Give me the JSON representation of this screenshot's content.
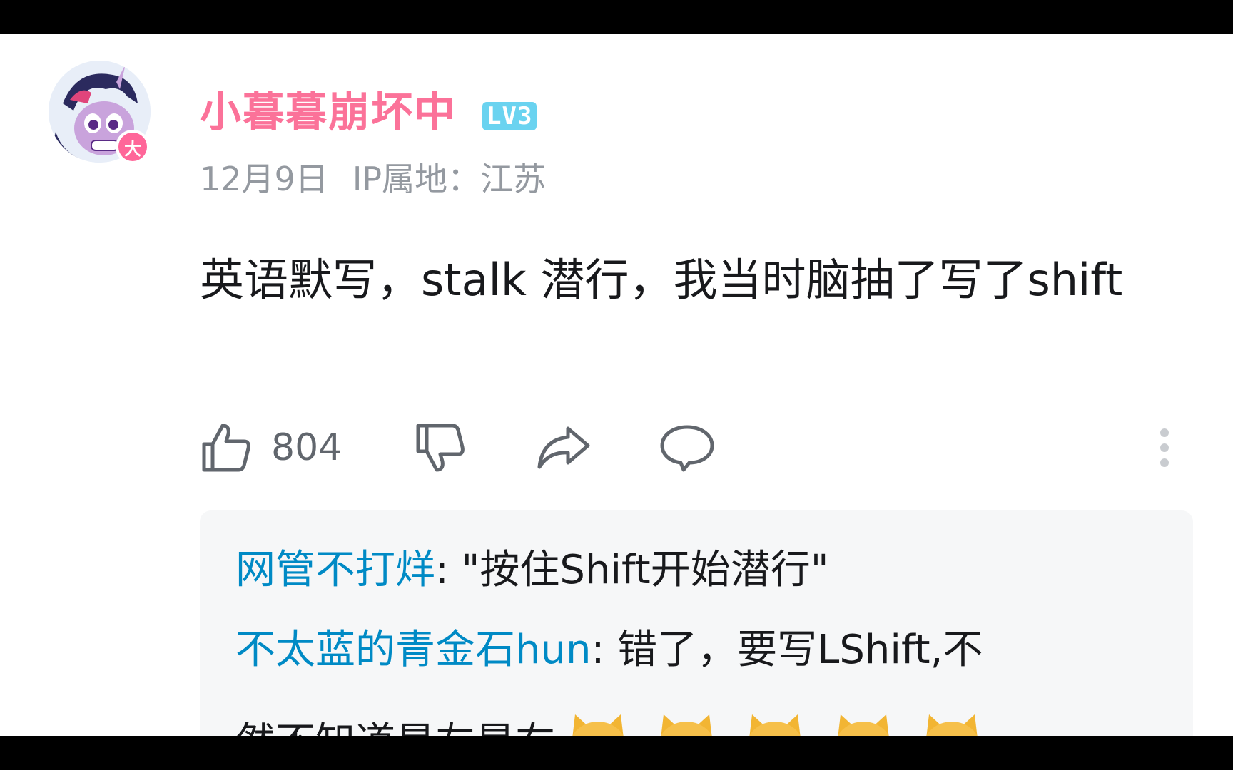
{
  "comment": {
    "username": "小暮暮崩坏中",
    "level": "LV3",
    "vip_badge": "大",
    "date": "12月9日",
    "ip_location": "IP属地：江苏",
    "text": "英语默写，stalk  潜行，我当时脑抽了写了shift"
  },
  "actions": {
    "like_count": "804",
    "icons": [
      "thumbs-up-icon",
      "thumbs-down-icon",
      "share-icon",
      "reply-icon",
      "more-icon"
    ]
  },
  "replies": [
    {
      "name": "网管不打烊",
      "sep": ": ",
      "text": "\"按住Shift开始潜行\""
    },
    {
      "name": "不太蓝的青金石hun",
      "sep": ": ",
      "text": "错了，要写LShift,不"
    },
    {
      "continuation": "然不知道是左是右",
      "emoji": "doge",
      "emoji_count": 5
    }
  ],
  "colors": {
    "username": "#fb7299",
    "level_badge": "#6ad3f0",
    "reply_name": "#008ac5",
    "meta_text": "#9499a0",
    "reply_bg": "#f6f7f8"
  }
}
